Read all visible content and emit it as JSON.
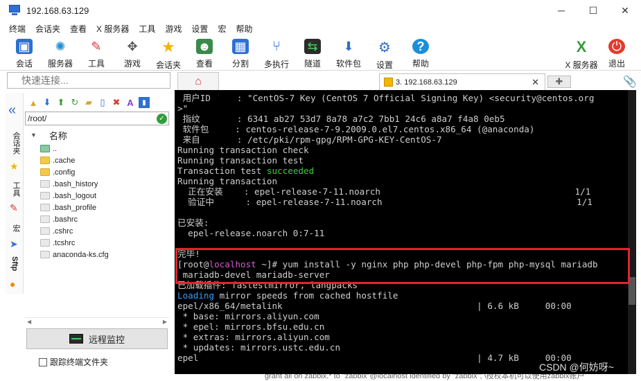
{
  "window": {
    "title": "192.168.63.129",
    "minimize": "─",
    "maximize": "☐",
    "close": "✕"
  },
  "menu": [
    "终端",
    "会话夹",
    "查看",
    "X 服务器",
    "工具",
    "游戏",
    "设置",
    "宏",
    "帮助"
  ],
  "toolbar": {
    "left": [
      {
        "label": "会话",
        "icon": "session-icon"
      },
      {
        "label": "服务器",
        "icon": "servers-icon"
      },
      {
        "label": "工具",
        "icon": "tools-icon"
      },
      {
        "label": "游戏",
        "icon": "games-icon"
      },
      {
        "label": "会话夹",
        "icon": "star-icon"
      },
      {
        "label": "查看",
        "icon": "view-icon"
      },
      {
        "label": "分割",
        "icon": "split-icon"
      },
      {
        "label": "多执行",
        "icon": "multiexec-icon"
      },
      {
        "label": "隧道",
        "icon": "tunnel-icon"
      },
      {
        "label": "软件包",
        "icon": "package-icon"
      },
      {
        "label": "设置",
        "icon": "settings-icon"
      },
      {
        "label": "帮助",
        "icon": "help-icon"
      }
    ],
    "right": [
      {
        "label": "X 服务器",
        "icon": "x-server-icon"
      },
      {
        "label": "退出",
        "icon": "power-icon"
      }
    ]
  },
  "quick_connect": {
    "placeholder": "快速连接..."
  },
  "tabs": {
    "session_tab": "3. 192.168.63.129",
    "close": "✕"
  },
  "sidebar": {
    "labels": [
      "会话夹",
      "工具",
      "宏",
      "Sftp"
    ]
  },
  "sftp": {
    "path": "/root/",
    "column_name": "名称",
    "files": [
      {
        "name": "..",
        "type": "up"
      },
      {
        "name": ".cache",
        "type": "folder"
      },
      {
        "name": ".config",
        "type": "folder"
      },
      {
        "name": ".bash_history",
        "type": "file"
      },
      {
        "name": ".bash_logout",
        "type": "file"
      },
      {
        "name": ".bash_profile",
        "type": "file"
      },
      {
        "name": ".bashrc",
        "type": "file"
      },
      {
        "name": ".cshrc",
        "type": "file"
      },
      {
        "name": ".tcshrc",
        "type": "file"
      },
      {
        "name": "anaconda-ks.cfg",
        "type": "file"
      }
    ],
    "remote_monitor": "远程监控",
    "follow_terminal": "跟踪终端文件夹"
  },
  "terminal": {
    "lines": [
      [
        {
          "t": " 用户ID     : \"CentOS-7 Key (CentOS 7 Official Signing Key) <security@centos.org"
        }
      ],
      [
        {
          "t": ">\""
        }
      ],
      [
        {
          "t": " 指纹       : 6341 ab27 53d7 8a78 a7c2 7bb1 24c6 a8a7 f4a8 0eb5"
        }
      ],
      [
        {
          "t": " 软件包     : centos-release-7-9.2009.0.el7.centos.x86_64 (@anaconda)"
        }
      ],
      [
        {
          "t": " 来自       : /etc/pki/rpm-gpg/RPM-GPG-KEY-CentOS-7"
        }
      ],
      [
        {
          "t": "Running transaction check"
        }
      ],
      [
        {
          "t": "Running transaction test"
        }
      ],
      [
        {
          "t": "Transaction test "
        },
        {
          "t": "succeeded",
          "c": "green"
        }
      ],
      [
        {
          "t": "Running transaction"
        }
      ],
      [
        {
          "t": "  正在安装    : epel-release-7-11.noarch                                     1/1"
        }
      ],
      [
        {
          "t": "  验证中      : epel-release-7-11.noarch                                     1/1"
        }
      ],
      [
        {
          "t": ""
        }
      ],
      [
        {
          "t": "已安装:"
        }
      ],
      [
        {
          "t": "  epel-release.noarch 0:7-11"
        }
      ],
      [
        {
          "t": ""
        }
      ],
      [
        {
          "t": "完毕!"
        }
      ],
      [
        {
          "t": "[root@"
        },
        {
          "t": "localhost",
          "c": "magenta"
        },
        {
          "t": " ~]# yum install -y nginx php php-devel php-fpm php-mysql mariadb"
        }
      ],
      [
        {
          "t": " mariadb-devel mariadb-server"
        }
      ],
      [
        {
          "t": "已加载插件: fastestmirror, langpacks"
        }
      ],
      [
        {
          "t": "Loading",
          "c": "blue"
        },
        {
          "t": " mirror speeds from cached hostfile"
        }
      ],
      [
        {
          "t": "epel/x86_64/metalink                                     | 6.6 kB     00:00"
        }
      ],
      [
        {
          "t": " * base: mirrors.aliyun.com"
        }
      ],
      [
        {
          "t": " * epel: mirrors.bfsu.edu.cn"
        }
      ],
      [
        {
          "t": " * extras: mirrors.aliyun.com"
        }
      ],
      [
        {
          "t": " * updates: mirrors.ustc.edu.cn"
        }
      ],
      [
        {
          "t": "epel                                                     | 4.7 kB     00:00"
        }
      ]
    ]
  },
  "watermark": "CSDN @何妨呀~",
  "bottom_text": "grant all on zabbix.* to \"zabbix\"@localhost identified by \"zabbix\";   \\授权本机可以使用zabbix账户"
}
